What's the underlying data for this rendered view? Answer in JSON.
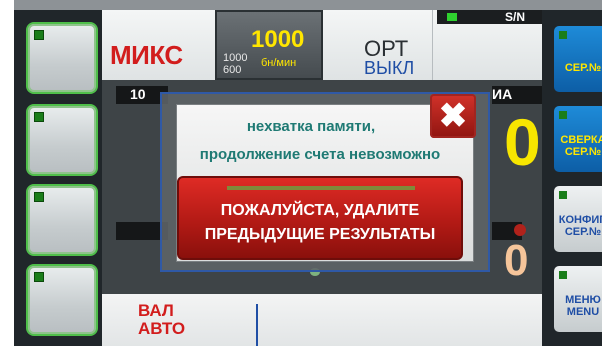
{
  "header": {
    "mode": "МИКС",
    "speed": {
      "value": "1000",
      "option_high": "1000",
      "option_low": "600",
      "unit": "бн/мин"
    },
    "orientation": {
      "label": "ОРТ",
      "state": "ВЫКЛ"
    },
    "serial_indicator": "S/N"
  },
  "counter": {
    "left_label": "10",
    "right_label": "ИА",
    "count_main": "0",
    "count_secondary": "0"
  },
  "bottom": {
    "currency_line1": "ВАЛ",
    "currency_line2": "АВТО"
  },
  "right_menu": [
    {
      "line1": "СЕР.№",
      "line2": "",
      "style": "blue"
    },
    {
      "line1": "СВЕРКА",
      "line2": "СЕР.№",
      "style": "blue"
    },
    {
      "line1": "КОНФИГ.",
      "line2": "СЕР.№",
      "style": "gray"
    },
    {
      "line1": "МЕНЮ",
      "line2": "MENU",
      "style": "gray"
    }
  ],
  "dialog": {
    "message_line1": "нехватка памяти,",
    "message_line2": "продолжение счета невозможно",
    "action_line1": "ПОЖАЛУЙСТА, УДАЛИТЕ",
    "action_line2": "ПРЕДЫДУЩИЕ РЕЗУЛЬТАТЫ",
    "close_symbol": "✖"
  },
  "colors": {
    "accent_red": "#d21d1d",
    "accent_yellow": "#ffe600",
    "accent_blue": "#1f4ea5",
    "message_teal": "#1f7a74"
  }
}
